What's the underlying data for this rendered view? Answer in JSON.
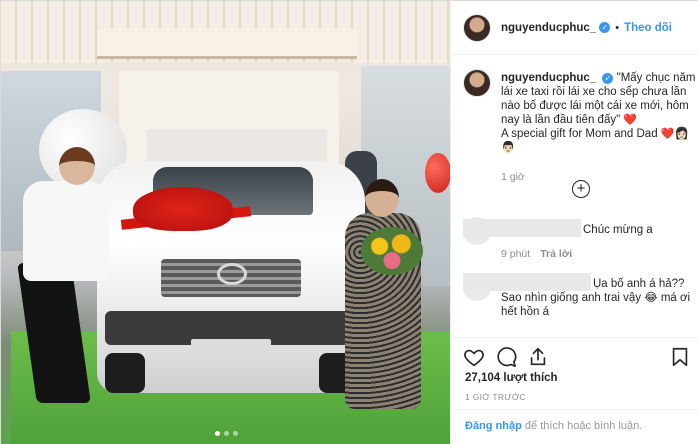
{
  "header": {
    "username": "nguyenducphuc_",
    "separator": "•",
    "follow_label": "Theo dõi"
  },
  "caption": {
    "username": "nguyenducphuc_",
    "text": "\"Mấy chục năm lái xe taxi rồi lái xe cho sếp chưa lần nào bố được lái một cái xe mới, hôm nay là lần đầu tiên đấy\"",
    "text2": "A special gift for Mom and Dad",
    "heart": "❤️",
    "emoji_person": "👨🏻",
    "emoji_person2": "👩🏻",
    "time": "1 giờ"
  },
  "comments": [
    {
      "text": "Chúc mừng a",
      "time": "9 phút",
      "reply_label": "Trả lời"
    },
    {
      "text_line1": "Ụa bố anh á hả??",
      "text_line2": "Sao nhìn giống anh trai vậy 😂 má ơi hết hồn á"
    }
  ],
  "load_more_symbol": "+",
  "actions": {
    "likes": "27,104 lượt thích",
    "date": "1 GIỜ TRƯỚC"
  },
  "footer": {
    "login_link": "Đăng nhập",
    "login_suffix": " để thích hoặc bình luận."
  },
  "photo": {
    "dot_count": 3,
    "active_dot": 1
  },
  "colors": {
    "accent": "#3897f0",
    "heart": "#ed4956",
    "muted": "#8e8e8e"
  }
}
